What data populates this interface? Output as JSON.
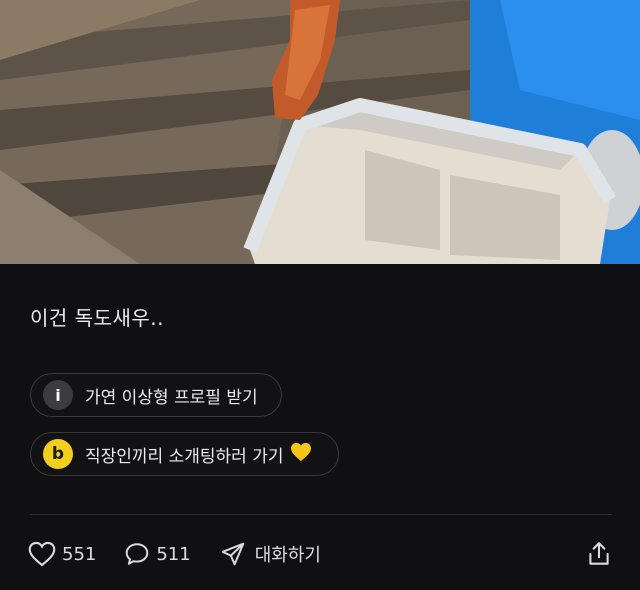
{
  "post": {
    "caption": "이건 독도새우.."
  },
  "chips": [
    {
      "icon": "info-icon",
      "icon_text": "i",
      "label": "가연 이상형 프로필 받기"
    },
    {
      "icon": "b-logo-icon",
      "icon_text": "b",
      "label": "직장인끼리 소개팅하러 가기"
    }
  ],
  "actions": {
    "likes": "551",
    "comments": "511",
    "chat_label": "대화하기"
  },
  "colors": {
    "background": "#101012",
    "chip_border": "#3a3a40",
    "b_icon": "#f2cf1d"
  }
}
